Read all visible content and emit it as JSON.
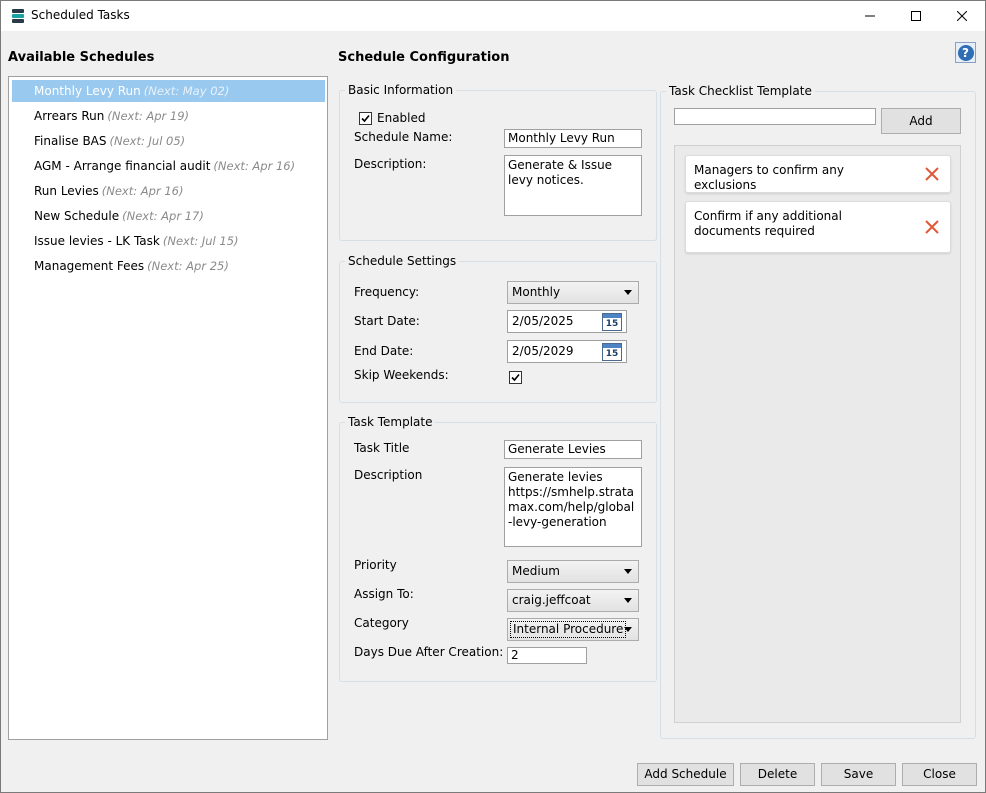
{
  "window": {
    "title": "Scheduled Tasks"
  },
  "left_panel": {
    "heading": "Available Schedules",
    "schedules": [
      {
        "name": "Monthly Levy Run",
        "next": "(Next: May 02)",
        "selected": true
      },
      {
        "name": "Arrears Run",
        "next": "(Next: Apr 19)",
        "selected": false
      },
      {
        "name": "Finalise BAS",
        "next": "(Next: Jul 05)",
        "selected": false
      },
      {
        "name": "AGM - Arrange financial audit",
        "next": "(Next: Apr 16)",
        "selected": false
      },
      {
        "name": "Run Levies",
        "next": "(Next: Apr 16)",
        "selected": false
      },
      {
        "name": "New Schedule",
        "next": "(Next: Apr 17)",
        "selected": false
      },
      {
        "name": "Issue levies - LK Task",
        "next": "(Next: Jul 15)",
        "selected": false
      },
      {
        "name": "Management Fees",
        "next": "(Next: Apr 25)",
        "selected": false
      }
    ]
  },
  "config": {
    "heading": "Schedule Configuration",
    "basic": {
      "title": "Basic Information",
      "enabled_label": "Enabled",
      "enabled": true,
      "name_label": "Schedule Name:",
      "name_value": "Monthly Levy Run",
      "desc_label": "Description:",
      "desc_value": "Generate & Issue levy notices."
    },
    "settings": {
      "title": "Schedule Settings",
      "frequency_label": "Frequency:",
      "frequency_value": "Monthly",
      "start_label": "Start Date:",
      "start_value": "2/05/2025",
      "end_label": "End Date:",
      "end_value": "2/05/2029",
      "calendar_day": "15",
      "skip_label": "Skip Weekends:",
      "skip_weekends": true
    },
    "task": {
      "title": "Task Template",
      "title_label": "Task Title",
      "title_value": "Generate Levies",
      "desc_label": "Description",
      "desc_value": "Generate levies https://smhelp.stratamax.com/help/global-levy-generation",
      "priority_label": "Priority",
      "priority_value": "Medium",
      "assign_label": "Assign To:",
      "assign_value": "craig.jeffcoat",
      "category_label": "Category",
      "category_value": "Internal Procedure",
      "days_label": "Days Due After Creation:",
      "days_value": "2"
    }
  },
  "checklist": {
    "title": "Task Checklist Template",
    "input_value": "",
    "add_label": "Add",
    "items": [
      {
        "text": "Managers to confirm any exclusions"
      },
      {
        "text": "Confirm if any additional documents required"
      }
    ]
  },
  "footer": {
    "add_schedule": "Add Schedule",
    "delete": "Delete",
    "save": "Save",
    "close": "Close"
  },
  "colors": {
    "selection": "#99c9ef",
    "delete_x": "#e05a3a",
    "help": "#2f6db5"
  },
  "icons": {
    "help": "?"
  }
}
